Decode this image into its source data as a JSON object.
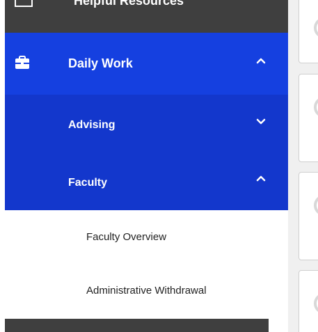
{
  "sidebar": {
    "top_item": {
      "label": "Helpful Resources",
      "icon": "book-icon"
    },
    "daily_work": {
      "label": "Daily Work",
      "icon": "briefcase-icon",
      "expanded": true,
      "chevron": "chevron-up-icon"
    },
    "sub_items": [
      {
        "label": "Advising",
        "expanded": false,
        "chevron": "chevron-down-icon"
      },
      {
        "label": "Faculty",
        "expanded": true,
        "chevron": "chevron-up-icon"
      }
    ],
    "links": [
      {
        "label": "Faculty Overview"
      },
      {
        "label": "Administrative Withdrawal"
      }
    ]
  },
  "colors": {
    "dark_bar": "#3f3f3f",
    "active_blue": "#1540e0",
    "sub_blue": "#1337cc",
    "card_border": "#cfcfcf",
    "background": "#f0f0f0"
  }
}
